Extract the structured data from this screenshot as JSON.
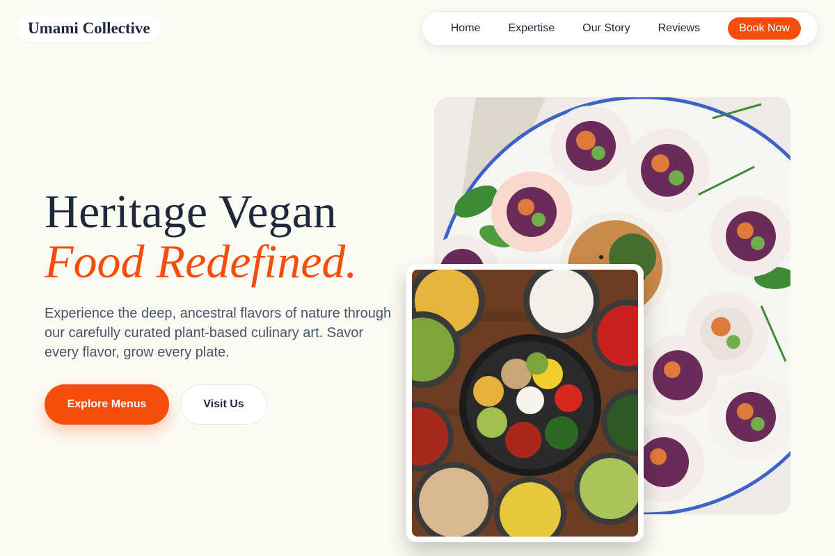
{
  "brand": {
    "name": "Umami Collective"
  },
  "nav": {
    "links": [
      "Home",
      "Expertise",
      "Our Story",
      "Reviews"
    ],
    "cta": "Book Now"
  },
  "hero": {
    "title_line1": "Heritage Vegan",
    "title_line2": "Food Redefined.",
    "description": "Experience the deep, ancestral flavors of nature through our carefully curated plant-based culinary art. Savor every flavor, grow every plate.",
    "primary_button": "Explore Menus",
    "secondary_button": "Visit Us"
  },
  "colors": {
    "accent": "#f64d0c",
    "background": "#fcfbf3",
    "heading": "#1e293b",
    "body_text": "#475569"
  }
}
